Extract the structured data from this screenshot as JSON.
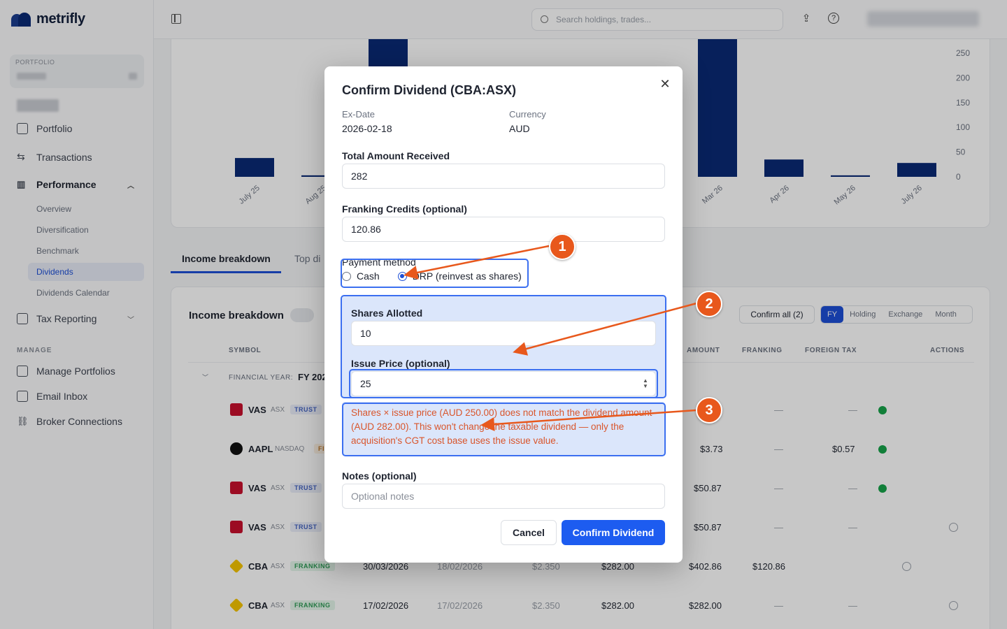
{
  "app": {
    "name": "metrifly"
  },
  "sidebar": {
    "portfolio_label": "PORTFOLIO",
    "nav": [
      {
        "label": "Portfolio",
        "icon": "briefcase-icon"
      },
      {
        "label": "Transactions",
        "icon": "arrows-exchange-icon"
      },
      {
        "label": "Performance",
        "icon": "bar-chart-icon"
      },
      {
        "label": "Tax Reporting",
        "icon": "calculator-icon"
      }
    ],
    "performance_sub": [
      "Overview",
      "Diversification",
      "Benchmark",
      "Dividends",
      "Dividends Calendar"
    ],
    "manage_label": "MANAGE",
    "manage": [
      "Manage Portfolios",
      "Email Inbox",
      "Broker Connections"
    ]
  },
  "topbar": {
    "search_placeholder": "Search holdings, trades..."
  },
  "chart_data": {
    "type": "bar",
    "categories": [
      "July 25",
      "Aug 25",
      "Mar 26",
      "Apr 26",
      "May 26",
      "July 26"
    ],
    "values": [
      38,
      3,
      290,
      35,
      3,
      28
    ],
    "y_ticks": [
      "250",
      "200",
      "150",
      "100",
      "50",
      "0"
    ],
    "ylim": [
      0,
      250
    ]
  },
  "tabs": [
    "Income breakdown",
    "Top di"
  ],
  "table": {
    "title": "Income breakdown",
    "confirm_all": "Confirm all (2)",
    "segments": [
      "FY",
      "Holding",
      "Exchange",
      "Month"
    ],
    "headers": [
      "SYMBOL",
      "AMOUNT",
      "FRANKING",
      "FOREIGN TAX",
      "ACTIONS"
    ],
    "fy_label": "FINANCIAL YEAR:",
    "fy_value": "FY 202",
    "rows": [
      {
        "symbol": "VAS",
        "exchange": "ASX",
        "badge": "TRUST",
        "date1": "",
        "date2": "",
        "rate": "",
        "gross": "",
        "amount": "—",
        "franking": "—",
        "foreign": "—",
        "status": "confirmed"
      },
      {
        "symbol": "AAPL",
        "exchange": "NASDAQ",
        "badge": "FIT",
        "date1": "",
        "date2": "",
        "rate": "",
        "gross": "",
        "amount": "$3.73",
        "franking": "—",
        "foreign": "$0.57",
        "status": "confirmed"
      },
      {
        "symbol": "VAS",
        "exchange": "ASX",
        "badge": "TRUST",
        "date1": "",
        "date2": "",
        "rate": "",
        "gross": "",
        "amount": "$50.87",
        "franking": "—",
        "foreign": "—",
        "status": "confirmed"
      },
      {
        "symbol": "VAS",
        "exchange": "ASX",
        "badge": "TRUST",
        "date1": "",
        "date2": "",
        "rate": "",
        "gross": "",
        "amount": "$50.87",
        "franking": "—",
        "foreign": "—",
        "status": "pending"
      },
      {
        "symbol": "CBA",
        "exchange": "ASX",
        "badge": "FRANKING",
        "date1": "30/03/2026",
        "date2": "18/02/2026",
        "rate": "$2.350",
        "gross": "$282.00",
        "amount": "$402.86",
        "franking": "$120.86",
        "foreign": "",
        "status": "pending"
      },
      {
        "symbol": "CBA",
        "exchange": "ASX",
        "badge": "FRANKING",
        "date1": "17/02/2026",
        "date2": "17/02/2026",
        "rate": "$2.350",
        "gross": "$282.00",
        "amount": "$282.00",
        "franking": "—",
        "foreign": "—",
        "status": "pending"
      }
    ]
  },
  "modal": {
    "title": "Confirm Dividend (CBA:ASX)",
    "ex_date_label": "Ex-Date",
    "ex_date": "2026-02-18",
    "currency_label": "Currency",
    "currency": "AUD",
    "total_label": "Total Amount Received",
    "total_value": "282",
    "franking_label": "Franking Credits (optional)",
    "franking_value": "120.86",
    "payment_label": "Payment method",
    "payment_options": [
      "Cash",
      "DRP (reinvest as shares)"
    ],
    "payment_selected": "DRP (reinvest as shares)",
    "shares_label": "Shares Allotted",
    "shares_value": "10",
    "issue_label": "Issue Price (optional)",
    "issue_value": "25",
    "warning": "Shares × issue price (AUD 250.00) does not match the dividend amount (AUD 282.00). This won't change the taxable dividend — only the acquisition's CGT cost base uses the issue value.",
    "notes_label": "Notes (optional)",
    "notes_placeholder": "Optional notes",
    "cancel": "Cancel",
    "confirm": "Confirm Dividend"
  },
  "annotations": [
    "1",
    "2",
    "3"
  ],
  "colors": {
    "accent": "#1d5cf0",
    "bar": "#0a2a75",
    "warning": "#d9552b",
    "callout": "#e8581c"
  }
}
